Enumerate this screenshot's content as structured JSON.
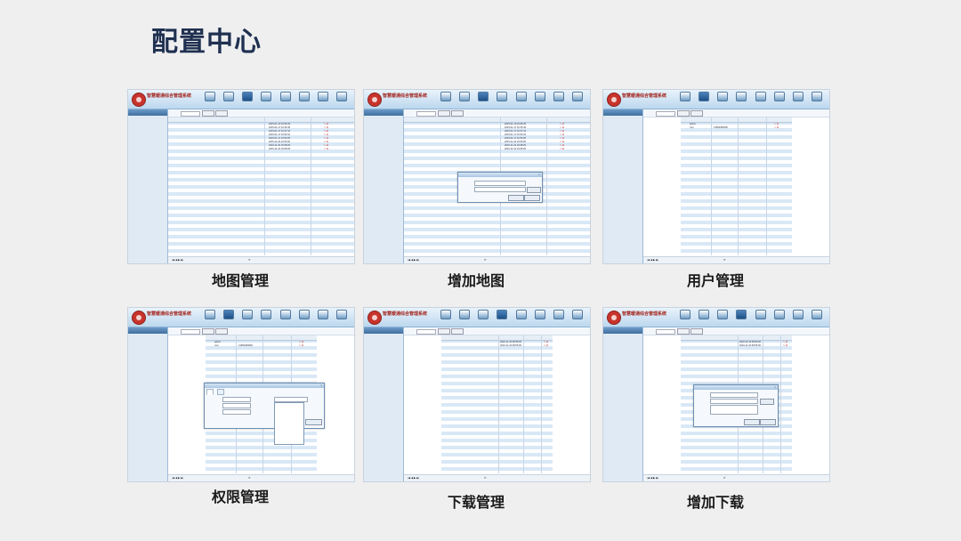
{
  "page": {
    "title": "配置中心"
  },
  "colors": {
    "title": "#1f3050",
    "header_bg": "#bcd7ee",
    "stripe": "#d9e8f6",
    "logo": "#c8342c"
  },
  "app": {
    "title": "智慧暖通综合管理系统",
    "subtitle": "",
    "exit_label": "",
    "nav": [
      {
        "label": "",
        "icon": "home-icon"
      },
      {
        "label": "",
        "icon": "monitor-icon"
      },
      {
        "label": "",
        "icon": "map-icon"
      },
      {
        "label": "",
        "icon": "chart-icon"
      },
      {
        "label": "",
        "icon": "list-icon"
      },
      {
        "label": "",
        "icon": "database-icon"
      },
      {
        "label": "",
        "icon": "alarm-icon"
      },
      {
        "label": "",
        "icon": "user-icon"
      }
    ],
    "sidebar_title": "",
    "sidebar_items": [
      "",
      "",
      "",
      "",
      "",
      "",
      ""
    ],
    "sidebar_config": "",
    "sidebar_sub": [
      "",
      "",
      ""
    ]
  },
  "shots": [
    {
      "caption": "地图管理",
      "active_nav": 2,
      "active_sub": 1,
      "toolbar": {
        "label": "",
        "btn1": "",
        "btn2": ""
      },
      "headers": [
        "",
        "",
        ""
      ],
      "rows": [
        [
          "",
          "2015-01-13 10:06:25"
        ],
        [
          "",
          "2015-01-17 10:25:46"
        ],
        [
          "",
          "2015-01-17 10:47:16"
        ],
        [
          "",
          "2015-01-17 10:53:10"
        ],
        [
          "",
          "2015-01-17 10:53:25"
        ],
        [
          "",
          "2015-11-19 10:05:06"
        ],
        [
          "",
          "2016-11-16 16:08:29"
        ],
        [
          "",
          "2016-11-16 16:08:39"
        ]
      ]
    },
    {
      "caption": "增加地图",
      "active_nav": 2,
      "active_sub": 1,
      "toolbar": {
        "label": "",
        "btn1": "",
        "btn2": ""
      },
      "headers": [
        "",
        "",
        ""
      ],
      "rows": [
        [
          "",
          "2015-01-13 10:06:25"
        ],
        [
          "",
          "2015-01-17 10:25:46"
        ],
        [
          "",
          "2015-01-17 10:47:16"
        ],
        [
          "",
          "2015-01-17 10:53:10"
        ],
        [
          "",
          "2015-01-17 10:53:25"
        ],
        [
          "",
          "2015-11-19 10:05:06"
        ],
        [
          "",
          "2016-11-16 16:08:29"
        ],
        [
          "",
          "2016-11-16 16:08:39"
        ]
      ],
      "dialog": {
        "title": "",
        "field1": "",
        "field2": "",
        "browse": "",
        "ok": "",
        "cancel": ""
      }
    },
    {
      "caption": "用户管理",
      "active_nav": 1,
      "active_sub": 0,
      "toolbar": {
        "label": "",
        "btn1": "",
        "btn2": ""
      },
      "headers": [
        "",
        "",
        "",
        ""
      ],
      "rows": [
        [
          "admin",
          "",
          ""
        ],
        [
          "root",
          "13952383666",
          ""
        ]
      ]
    },
    {
      "caption": "权限管理",
      "active_nav": 1,
      "active_sub": 0,
      "toolbar": {
        "label": "",
        "btn1": "",
        "btn2": ""
      },
      "headers": [
        "",
        "",
        "",
        ""
      ],
      "rows": [
        [
          "admin",
          "",
          ""
        ],
        [
          "root",
          "13952383666",
          ""
        ]
      ],
      "dialog": {
        "title": "",
        "tab1": "",
        "tab2": "",
        "field1": "",
        "field2": "",
        "field3": "",
        "field4": "",
        "field5": "",
        "tree": [
          "",
          "",
          "",
          "",
          "",
          "",
          "",
          ""
        ],
        "ok": ""
      }
    },
    {
      "caption": "下载管理",
      "active_nav": 3,
      "active_sub": 2,
      "toolbar": {
        "label": "",
        "btn1": "",
        "btn2": ""
      },
      "headers": [
        "",
        "",
        "",
        ""
      ],
      "rows": [
        [
          "",
          "2016-11-16 08:56:46"
        ],
        [
          "",
          "2016-11-16 08:55:06"
        ]
      ]
    },
    {
      "caption": "增加下载",
      "active_nav": 3,
      "active_sub": 2,
      "toolbar": {
        "label": "",
        "btn1": "",
        "btn2": ""
      },
      "headers": [
        "",
        "",
        "",
        ""
      ],
      "rows": [
        [
          "",
          "2016-11-16 08:56:46"
        ],
        [
          "",
          "2016-11-16 08:55:06"
        ]
      ],
      "dialog": {
        "title": "",
        "field1": "",
        "field2": "",
        "field3": "",
        "browse": "",
        "ok": "",
        "cancel": ""
      }
    }
  ]
}
